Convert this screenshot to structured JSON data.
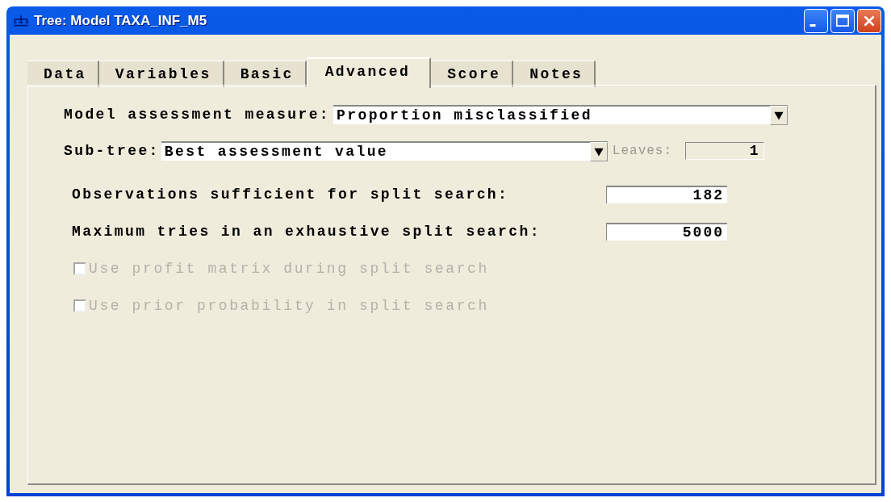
{
  "window": {
    "title": "Tree: Model TAXA_INF_M5"
  },
  "tabs": [
    {
      "label": "Data",
      "selected": false
    },
    {
      "label": "Variables",
      "selected": false
    },
    {
      "label": "Basic",
      "selected": false
    },
    {
      "label": "Advanced",
      "selected": true
    },
    {
      "label": "Score",
      "selected": false
    },
    {
      "label": "Notes",
      "selected": false
    }
  ],
  "assessment": {
    "label": "Model assessment measure:",
    "value": "Proportion misclassified"
  },
  "subtree": {
    "label": "Sub-tree:",
    "value": "Best assessment value"
  },
  "leaves": {
    "label": "Leaves:",
    "value": "1",
    "disabled": true
  },
  "fields": [
    {
      "label": "Observations sufficient for split search:",
      "value": "182"
    },
    {
      "label": "Maximum tries in an exhaustive split search:",
      "value": "5000"
    }
  ],
  "checkboxes": [
    {
      "label": "Use profit matrix during split search",
      "checked": false,
      "disabled": true
    },
    {
      "label": "Use prior probability in split search",
      "checked": false,
      "disabled": true
    }
  ]
}
